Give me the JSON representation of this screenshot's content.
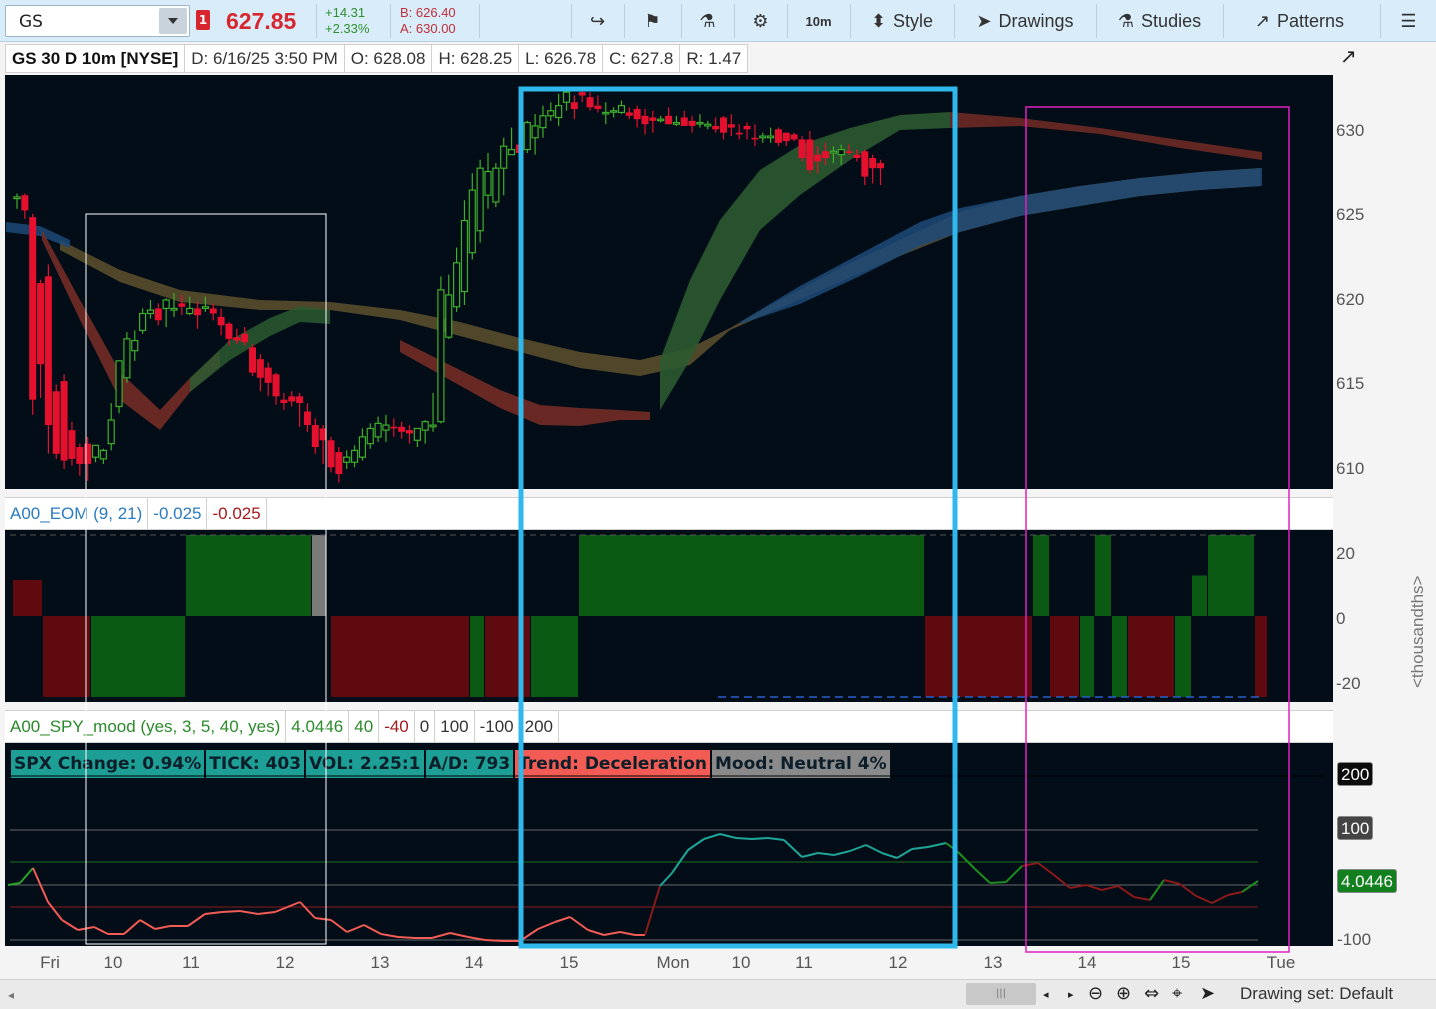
{
  "toolbar": {
    "symbol": "GS",
    "alert_count": "1",
    "last_price": "627.85",
    "change_abs": "+14.31",
    "change_pct": "+2.33%",
    "bid": "B: 626.40",
    "ask": "A: 630.00",
    "timeframe_label": "10m",
    "style_label": "Style",
    "drawings_label": "Drawings",
    "studies_label": "Studies",
    "patterns_label": "Patterns"
  },
  "info_bar": {
    "title": "GS 30 D 10m [NYSE]",
    "date": "D: 6/16/25 3:50 PM",
    "open": "O: 628.08",
    "high": "H: 628.25",
    "low": "L: 626.78",
    "close": "C: 627.8",
    "range": "R: 1.47"
  },
  "eom_study": {
    "name": "A00_EOM (9, 21)",
    "value1": "-0.025",
    "value2": "-0.025",
    "axis_unit": "<thousandths>"
  },
  "mood_study": {
    "name": "A00_SPY_mood (yes, 3, 5, 40, yes)",
    "values": [
      "4.0446",
      "40",
      "-40",
      "0",
      "100",
      "-100",
      "200"
    ],
    "labels": [
      {
        "text": "SPX Change: 0.94%",
        "color": "#1e9f96"
      },
      {
        "text": "TICK: 403",
        "color": "#1e9f96"
      },
      {
        "text": "VOL: 2.25:1",
        "color": "#1e9f96"
      },
      {
        "text": "A/D: 793",
        "color": "#1e9f96"
      },
      {
        "text": "Trend: Deceleration",
        "color": "#f25c54"
      },
      {
        "text": "Mood: Neutral 4%",
        "color": "#8a8a8a"
      }
    ],
    "badges": [
      "200",
      "100",
      "4.0446",
      "-100"
    ]
  },
  "price_axis": [
    "630",
    "625",
    "620",
    "615",
    "610"
  ],
  "eom_axis": [
    "20",
    "0",
    "-20"
  ],
  "time_axis": [
    "Fri",
    "10",
    "11",
    "12",
    "13",
    "14",
    "15",
    "Mon",
    "10",
    "11",
    "12",
    "13",
    "14",
    "15",
    "Tue"
  ],
  "status_bar": {
    "drawing_set": "Drawing set: Default"
  },
  "colors": {
    "up": "#3fae2a",
    "down": "#e5102d",
    "background": "#020d18",
    "highlight_cyan": "#2fb8ec",
    "highlight_magenta": "#e020c0",
    "box_white": "#ffffff",
    "eom_pos": "#0b5a14",
    "eom_neg": "#5e0a0e",
    "eom_neutral": "#7a7a7a",
    "mood_up": "#1fa598",
    "mood_down": "#f25c54"
  },
  "chart_data": {
    "type": "candlestick",
    "symbol": "GS",
    "interval": "10m",
    "ylim": [
      608,
      632
    ],
    "bars": [
      [
        626,
        626.3,
        625.4,
        626.1
      ],
      [
        626.2,
        626.3,
        624.8,
        625.3
      ],
      [
        624.9,
        625.1,
        613.2,
        614.1
      ],
      [
        621,
        621.2,
        614.2,
        616.2
      ],
      [
        621.4,
        622.1,
        610.9,
        612.6
      ],
      [
        614.6,
        615,
        610.6,
        610.9
      ],
      [
        615.2,
        615.6,
        610,
        610.5
      ],
      [
        612.3,
        612.8,
        610.2,
        610.6
      ],
      [
        611.3,
        611.5,
        609.6,
        610.3
      ],
      [
        611.5,
        611.9,
        609.3,
        610.3
      ],
      [
        610.7,
        611.4,
        610.4,
        611.4
      ],
      [
        610.6,
        611.2,
        610.3,
        611.1
      ],
      [
        611.5,
        613.9,
        611.1,
        612.9
      ],
      [
        613.7,
        616.4,
        613.3,
        616.4
      ],
      [
        615.4,
        618.1,
        615.1,
        617.7
      ],
      [
        617,
        618.2,
        616.4,
        617.6
      ],
      [
        618.2,
        619.5,
        618,
        619.2
      ],
      [
        619.2,
        620,
        618.9,
        619.4
      ],
      [
        619.5,
        619.8,
        618.5,
        618.8
      ],
      [
        619.5,
        620.1,
        618.4,
        620
      ],
      [
        619.4,
        620.4,
        619,
        619.5
      ],
      [
        619.8,
        620.3,
        619.1,
        619.6
      ],
      [
        619.2,
        620.2,
        619.1,
        619.5
      ],
      [
        619.5,
        619.9,
        618.3,
        619.1
      ],
      [
        619.5,
        620.2,
        619.3,
        619.6
      ],
      [
        619.5,
        619.8,
        618.8,
        619.2
      ],
      [
        619,
        619.5,
        617.9,
        618.5
      ],
      [
        618.6,
        618.7,
        617.3,
        617.7
      ],
      [
        617.8,
        618.3,
        617.4,
        617.6
      ],
      [
        618,
        618.4,
        617.3,
        617.5
      ],
      [
        617.2,
        617.4,
        615.5,
        615.7
      ],
      [
        616.5,
        616.8,
        614.6,
        615.4
      ],
      [
        616,
        616.3,
        614.3,
        615.1
      ],
      [
        615.6,
        615.7,
        613.8,
        614.3
      ],
      [
        614.1,
        614.5,
        613.5,
        613.9
      ],
      [
        614.3,
        614.6,
        613.7,
        614
      ],
      [
        614.3,
        614.5,
        612.5,
        613.9
      ],
      [
        613.4,
        613.9,
        612.2,
        612.6
      ],
      [
        612.6,
        613,
        610.9,
        611.3
      ],
      [
        612.4,
        612.6,
        610.3,
        611.7
      ],
      [
        611.7,
        611.9,
        609.8,
        610.1
      ],
      [
        611,
        611.3,
        609.2,
        609.7
      ],
      [
        610.4,
        611.1,
        610,
        610.7
      ],
      [
        610.4,
        611.4,
        610.1,
        611.1
      ],
      [
        610.7,
        612.4,
        610.5,
        611.9
      ],
      [
        611.5,
        612.7,
        611.2,
        612.4
      ],
      [
        611.9,
        613.1,
        611.6,
        612.7
      ],
      [
        612.3,
        613.2,
        611.6,
        612.6
      ],
      [
        612.5,
        613,
        611.9,
        612.4
      ],
      [
        612.5,
        612.8,
        611.8,
        612.2
      ],
      [
        612.3,
        612.6,
        611.5,
        612.1
      ],
      [
        611.7,
        612.4,
        611.3,
        612.4
      ],
      [
        612.3,
        612.9,
        611.5,
        612.8
      ],
      [
        612.5,
        614.5,
        612.2,
        612.6
      ],
      [
        612.8,
        621.4,
        612.7,
        620.6
      ],
      [
        617.8,
        621.5,
        617.7,
        620.3
      ],
      [
        619.6,
        623.1,
        619.3,
        622.2
      ],
      [
        620.5,
        625.9,
        619.7,
        624.7
      ],
      [
        622.8,
        627.5,
        622.4,
        626.5
      ],
      [
        624.1,
        628.3,
        623.4,
        627.8
      ],
      [
        626.2,
        628.7,
        625.4,
        627.6
      ],
      [
        625.8,
        628.1,
        625.5,
        627.8
      ],
      [
        627.8,
        629.6,
        626.2,
        629.1
      ],
      [
        628.6,
        630.2,
        628.6,
        628.9
      ],
      [
        629.2,
        629.8,
        628,
        628.7
      ],
      [
        628.9,
        630.6,
        628.7,
        630.5
      ],
      [
        629.6,
        631,
        628.6,
        630.3
      ],
      [
        630.2,
        631.5,
        629.6,
        630.9
      ],
      [
        630.9,
        631.7,
        630.6,
        631.2
      ],
      [
        630.8,
        632.2,
        630.3,
        631.5
      ],
      [
        631.7,
        632.5,
        631.2,
        632.3
      ],
      [
        631.7,
        632.1,
        630.7,
        631.3
      ],
      [
        632.3,
        632.6,
        631.7,
        632.1
      ],
      [
        632,
        632.3,
        631.2,
        631.4
      ],
      [
        631.5,
        632.1,
        631.1,
        631.3
      ],
      [
        631.1,
        631.7,
        630.4,
        631.1
      ],
      [
        631.2,
        631.4,
        630.8,
        631.2
      ],
      [
        631.1,
        631.8,
        631,
        631.5
      ],
      [
        631.1,
        631.4,
        630.7,
        630.9
      ],
      [
        631.3,
        631.5,
        630.2,
        630.7
      ],
      [
        630.9,
        631.3,
        629.8,
        630.4
      ],
      [
        630.8,
        631.2,
        629.9,
        630.6
      ],
      [
        630.7,
        630.9,
        630.5,
        630.7
      ],
      [
        630.9,
        631.4,
        630.4,
        630.4
      ],
      [
        630.4,
        630.9,
        630.3,
        630.5
      ],
      [
        630.8,
        631.2,
        630.3,
        630.3
      ],
      [
        630.6,
        630.9,
        629.9,
        630.3
      ],
      [
        630.5,
        631,
        630.2,
        630.5
      ],
      [
        630.3,
        630.6,
        630.1,
        630.4
      ],
      [
        630.3,
        630.8,
        629.9,
        630.1
      ],
      [
        630.8,
        630.9,
        629.5,
        629.9
      ],
      [
        630.4,
        631,
        629.7,
        630.2
      ],
      [
        629.9,
        630.4,
        629.5,
        629.8
      ],
      [
        630.3,
        630.5,
        629.5,
        630.1
      ],
      [
        629.6,
        630.4,
        629.1,
        629.5
      ],
      [
        629.6,
        629.9,
        629.3,
        629.7
      ],
      [
        629.6,
        630.2,
        629.3,
        629.7
      ],
      [
        630.1,
        630.2,
        629.1,
        629.3
      ],
      [
        629.9,
        629.9,
        629.1,
        629.4
      ],
      [
        629.8,
        629.9,
        629.4,
        629.5
      ],
      [
        629.5,
        629.7,
        628.2,
        628.4
      ],
      [
        629.5,
        630,
        627.5,
        627.7
      ],
      [
        628.6,
        629.1,
        627.5,
        628.2
      ],
      [
        628.8,
        629.3,
        628,
        628.4
      ],
      [
        628.7,
        629.1,
        628.1,
        628.8
      ],
      [
        628.6,
        629.2,
        628,
        628.9
      ],
      [
        628.8,
        629.2,
        628.6,
        628.7
      ],
      [
        628.6,
        628.9,
        628.2,
        628.4
      ],
      [
        628.8,
        628.9,
        626.8,
        627.3
      ],
      [
        628.4,
        628.6,
        626.9,
        627.8
      ],
      [
        628.1,
        628.3,
        626.8,
        627.8
      ]
    ]
  }
}
